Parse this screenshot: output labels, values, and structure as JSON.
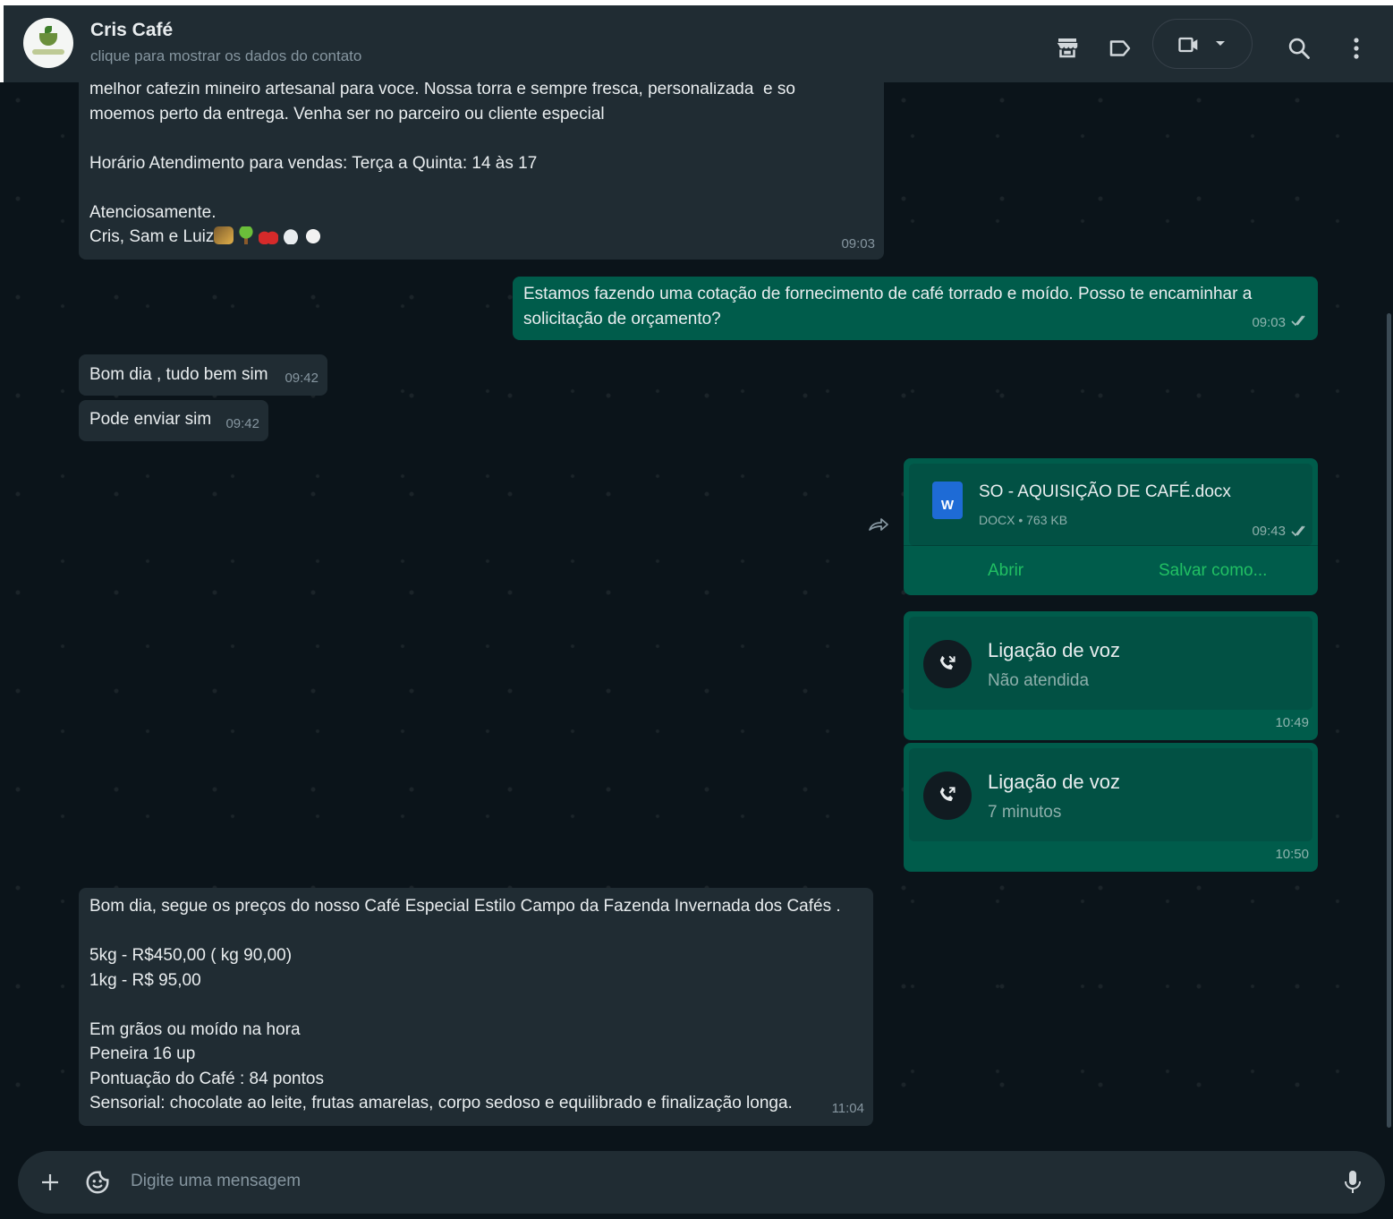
{
  "header": {
    "contact_name": "Cris Café",
    "contact_subtitle": "clique para mostrar os dados do contato",
    "icons": [
      "catalog-icon",
      "label-icon",
      "video-call-icon",
      "chevron-down-icon",
      "search-icon",
      "menu-icon"
    ]
  },
  "messages": {
    "m1": {
      "lines": [
        "melhor cafezin mineiro artesanal para voce. Nossa torra e sempre fresca, personalizada  e so",
        "moemos perto da entrega. Venha ser no parceiro ou cliente especial"
      ],
      "hours": "Horário Atendimento para vendas: Terça a Quinta: 14 às 17",
      "closing": "Atenciosamente.",
      "signature": "Cris, Sam e Luiz",
      "time": "09:03"
    },
    "m2": {
      "text1": "Estamos fazendo uma cotação de fornecimento de café torrado e moído. Posso te encaminhar a",
      "text2": "solicitação de orçamento?",
      "time": "09:03"
    },
    "m3": {
      "text": "Bom dia , tudo bem sim",
      "time": "09:42"
    },
    "m4": {
      "text": "Pode enviar sim",
      "time": "09:42"
    },
    "m5": {
      "file_name": "SO - AQUISIÇÃO DE CAFÉ.docx",
      "file_meta": "DOCX • 763 KB",
      "icon_letter": "W",
      "time": "09:43",
      "open_label": "Abrir",
      "save_label": "Salvar como..."
    },
    "m6": {
      "title": "Ligação de voz",
      "status": "Não atendida",
      "time": "10:49"
    },
    "m7": {
      "title": "Ligação de voz",
      "status": "7 minutos",
      "time": "10:50"
    },
    "m8": {
      "intro": "Bom dia, segue os preços do nosso Café Especial Estilo Campo da Fazenda Invernada dos Cafés .",
      "price1": "5kg - R$450,00 ( kg 90,00)",
      "price2": "1kg - R$ 95,00",
      "detail1": "Em grãos ou moído na hora",
      "detail2": "Peneira 16 up",
      "detail3": "Pontuação do Café : 84 pontos",
      "detail4": "Sensorial: chocolate ao leite, frutas amarelas, corpo sedoso e equilibrado e finalização longa.",
      "time": "11:04"
    }
  },
  "composer": {
    "placeholder": "Digite uma mensagem"
  },
  "colors": {
    "incoming_bubble": "#202c33",
    "outgoing_bubble": "#005c4b",
    "accent_green": "#21c063",
    "read_ticks": "#e9edef"
  }
}
